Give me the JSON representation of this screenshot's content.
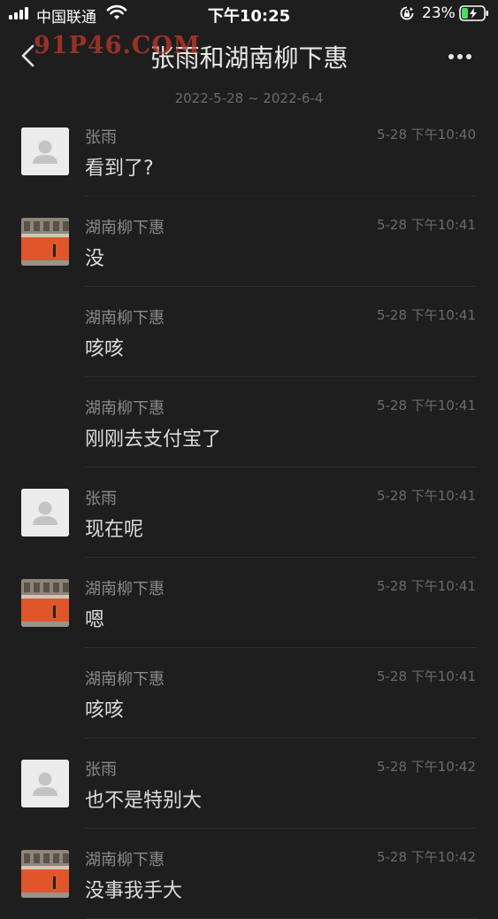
{
  "status_bar": {
    "carrier": "中国联通",
    "time": "下午10:25",
    "battery_percent": "23%"
  },
  "nav": {
    "title": "张雨和湖南柳下惠",
    "watermark": "91P46.COM"
  },
  "date_range": "2022-5-28 ~ 2022-6-4",
  "messages": [
    {
      "sender": "张雨",
      "time": "5-28 下午10:40",
      "text": "看到了?"
    },
    {
      "sender": "湖南柳下惠",
      "time": "5-28 下午10:41",
      "text": "没"
    },
    {
      "sender": "湖南柳下惠",
      "time": "5-28 下午10:41",
      "text": "咳咳"
    },
    {
      "sender": "湖南柳下惠",
      "time": "5-28 下午10:41",
      "text": "刚刚去支付宝了"
    },
    {
      "sender": "张雨",
      "time": "5-28 下午10:41",
      "text": "现在呢"
    },
    {
      "sender": "湖南柳下惠",
      "time": "5-28 下午10:41",
      "text": "嗯"
    },
    {
      "sender": "湖南柳下惠",
      "time": "5-28 下午10:41",
      "text": "咳咳"
    },
    {
      "sender": "张雨",
      "time": "5-28 下午10:42",
      "text": "也不是特别大"
    },
    {
      "sender": "湖南柳下惠",
      "time": "5-28 下午10:42",
      "text": "没事我手大"
    }
  ],
  "colors": {
    "background": "#1e1e1e",
    "watermark": "#c0392b",
    "battery_fill": "#4cd964"
  }
}
